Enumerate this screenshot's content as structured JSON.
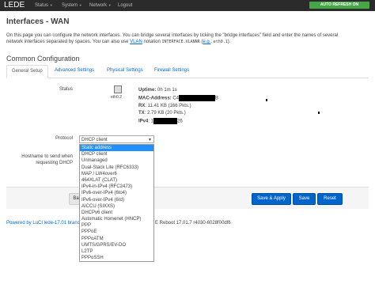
{
  "topbar": {
    "brand": "LEDE",
    "nav": [
      "Status",
      "System",
      "Network",
      "Logout"
    ],
    "autorefresh": "AUTO REFRESH ON"
  },
  "page": {
    "title": "Interfaces - WAN",
    "desc_1": "On this page you can configure the network interfaces. You can bridge several interfaces by ticking the \"bridge interfaces\" field and enter the names of several",
    "desc_2a": "network interfaces separated by spaces. You can also use ",
    "desc_vlan": "VLAN",
    "desc_2b": " notation ",
    "desc_code1": "INTERFACE.VLANNR",
    "desc_2c": " (",
    "desc_eg": "e.g.",
    "desc_2d": ": ",
    "desc_code2": "eth0.1",
    "desc_2e": ").",
    "section_title": "Common Configuration"
  },
  "tabs": [
    "General Setup",
    "Advanced Settings",
    "Physical Settings",
    "Firewall Settings"
  ],
  "status": {
    "label": "Status",
    "iface": "eth0.2",
    "uptime_k": "Uptime:",
    "uptime_v": "0h 1m 1s",
    "mac_k": "MAC-Address:",
    "mac_v1": "C4",
    "mac_v2": "B",
    "rx_k": "RX",
    "rx_v": ": 11.41 KB (166 Pkts.)",
    "tx_k": "TX",
    "tx_v": ": 2.79 KB (20 Pkts.)",
    "ipv4_k": "IPv4",
    "ipv4_v1": ": 1",
    "ipv4_v2": "26"
  },
  "protocol": {
    "label": "Protocol",
    "selected": "DHCP client",
    "options": [
      "Static address",
      "DHCP client",
      "Unmanaged",
      "Dual-Stack Lite (RFC6333)",
      "MAP / LW4over6",
      "464XLAT (CLAT)",
      "IPv4-in-IPv4 (RFC2473)",
      "IPv6-over-IPv4 (6to4)",
      "IPv6-over-IPv4 (6rd)",
      "AICCU (SIXXS)",
      "DHCPv6 client",
      "Automatic Homenet (HNCP)",
      "PPP",
      "PPPoE",
      "PPPoATM",
      "UMTS/GPRS/EV-DO",
      "L2TP",
      "PPPoSSH"
    ]
  },
  "hostname": {
    "label_1": "Hostname to send when",
    "label_2": "requesting DHCP"
  },
  "buttons": {
    "back": "Back",
    "save_apply": "Save & Apply",
    "save": "Save",
    "reset": "Reset"
  },
  "footer": {
    "powered": "Powered by LuCI lede-17.01 branc",
    "version": "E Reboot 17.01.7 r4030-6028f00df6"
  },
  "colors": {
    "topbar": "#2b2b2b",
    "autorefresh": "#46a546",
    "primary": "#0064cd",
    "link": "#0069d6",
    "selected": "#1e90ff"
  }
}
